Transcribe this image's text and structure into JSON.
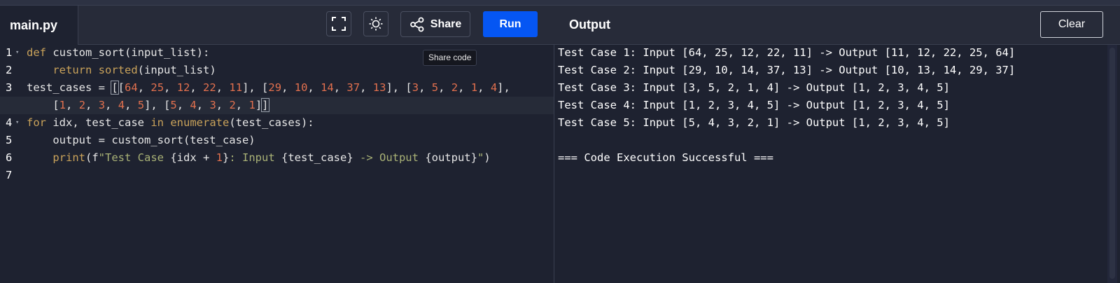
{
  "editor": {
    "file_tab": "main.py",
    "lines": [
      {
        "number": "1",
        "fold": true,
        "tokens": [
          {
            "t": "def",
            "c": "kw"
          },
          {
            "t": " custom_sort(input_list):"
          }
        ]
      },
      {
        "number": "2",
        "fold": false,
        "tokens": [
          {
            "t": "    "
          },
          {
            "t": "return",
            "c": "kw"
          },
          {
            "t": " "
          },
          {
            "t": "sorted",
            "c": "kw"
          },
          {
            "t": "(input_list)"
          }
        ]
      },
      {
        "number": "3",
        "fold": false,
        "tokens": [
          {
            "t": "test_cases = "
          },
          {
            "t": "[",
            "c": "br"
          },
          {
            "t": "[",
            "c": ""
          },
          {
            "t": "64",
            "c": "num"
          },
          {
            "t": ", "
          },
          {
            "t": "25",
            "c": "num"
          },
          {
            "t": ", "
          },
          {
            "t": "12",
            "c": "num"
          },
          {
            "t": ", "
          },
          {
            "t": "22",
            "c": "num"
          },
          {
            "t": ", "
          },
          {
            "t": "11",
            "c": "num"
          },
          {
            "t": "], ["
          },
          {
            "t": "29",
            "c": "num"
          },
          {
            "t": ", "
          },
          {
            "t": "10",
            "c": "num"
          },
          {
            "t": ", "
          },
          {
            "t": "14",
            "c": "num"
          },
          {
            "t": ", "
          },
          {
            "t": "37",
            "c": "num"
          },
          {
            "t": ", "
          },
          {
            "t": "13",
            "c": "num"
          },
          {
            "t": "], ["
          },
          {
            "t": "3",
            "c": "num"
          },
          {
            "t": ", "
          },
          {
            "t": "5",
            "c": "num"
          },
          {
            "t": ", "
          },
          {
            "t": "2",
            "c": "num"
          },
          {
            "t": ", "
          },
          {
            "t": "1",
            "c": "num"
          },
          {
            "t": ", "
          },
          {
            "t": "4",
            "c": "num"
          },
          {
            "t": "],"
          }
        ]
      },
      {
        "number": "",
        "fold": false,
        "active": true,
        "tokens": [
          {
            "t": "    ["
          },
          {
            "t": "1",
            "c": "num"
          },
          {
            "t": ", "
          },
          {
            "t": "2",
            "c": "num"
          },
          {
            "t": ", "
          },
          {
            "t": "3",
            "c": "num"
          },
          {
            "t": ", "
          },
          {
            "t": "4",
            "c": "num"
          },
          {
            "t": ", "
          },
          {
            "t": "5",
            "c": "num"
          },
          {
            "t": "], ["
          },
          {
            "t": "5",
            "c": "num"
          },
          {
            "t": ", "
          },
          {
            "t": "4",
            "c": "num"
          },
          {
            "t": ", "
          },
          {
            "t": "3",
            "c": "num"
          },
          {
            "t": ", "
          },
          {
            "t": "2",
            "c": "num"
          },
          {
            "t": ", "
          },
          {
            "t": "1",
            "c": "num"
          },
          {
            "t": "]"
          },
          {
            "t": "]",
            "c": "br"
          }
        ]
      },
      {
        "number": "4",
        "fold": true,
        "tokens": [
          {
            "t": "for",
            "c": "kw"
          },
          {
            "t": " idx, test_case "
          },
          {
            "t": "in",
            "c": "kw"
          },
          {
            "t": " "
          },
          {
            "t": "enumerate",
            "c": "kw"
          },
          {
            "t": "(test_cases):"
          }
        ]
      },
      {
        "number": "5",
        "fold": false,
        "tokens": [
          {
            "t": "    output = custom_sort(test_case)"
          }
        ]
      },
      {
        "number": "6",
        "fold": false,
        "tokens": [
          {
            "t": "    "
          },
          {
            "t": "print",
            "c": "kw"
          },
          {
            "t": "(f"
          },
          {
            "t": "\"Test Case ",
            "c": "str"
          },
          {
            "t": "{idx + "
          },
          {
            "t": "1",
            "c": "num"
          },
          {
            "t": "}"
          },
          {
            "t": ": Input ",
            "c": "str"
          },
          {
            "t": "{test_case}"
          },
          {
            "t": " -> Output ",
            "c": "str"
          },
          {
            "t": "{output}"
          },
          {
            "t": "\"",
            "c": "str"
          },
          {
            "t": ")"
          }
        ]
      },
      {
        "number": "7",
        "fold": false,
        "tokens": []
      }
    ]
  },
  "toolbar": {
    "fullscreen_icon": "fullscreen-icon",
    "theme_icon": "sun-icon",
    "share_icon": "share-icon",
    "share_label": "Share",
    "share_tooltip": "Share code",
    "run_label": "Run"
  },
  "output": {
    "title": "Output",
    "clear_label": "Clear",
    "lines": [
      "Test Case 1: Input [64, 25, 12, 22, 11] -> Output [11, 12, 22, 25, 64]",
      "Test Case 2: Input [29, 10, 14, 37, 13] -> Output [10, 13, 14, 29, 37]",
      "Test Case 3: Input [3, 5, 2, 1, 4] -> Output [1, 2, 3, 4, 5]",
      "Test Case 4: Input [1, 2, 3, 4, 5] -> Output [1, 2, 3, 4, 5]",
      "Test Case 5: Input [5, 4, 3, 2, 1] -> Output [1, 2, 3, 4, 5]",
      "",
      "=== Code Execution Successful ==="
    ]
  },
  "colors": {
    "background": "#1e2230",
    "header": "#272b39",
    "run_button": "#0556f3",
    "keyword": "#c9a25a",
    "number": "#e2704e",
    "string": "#a9b276"
  }
}
